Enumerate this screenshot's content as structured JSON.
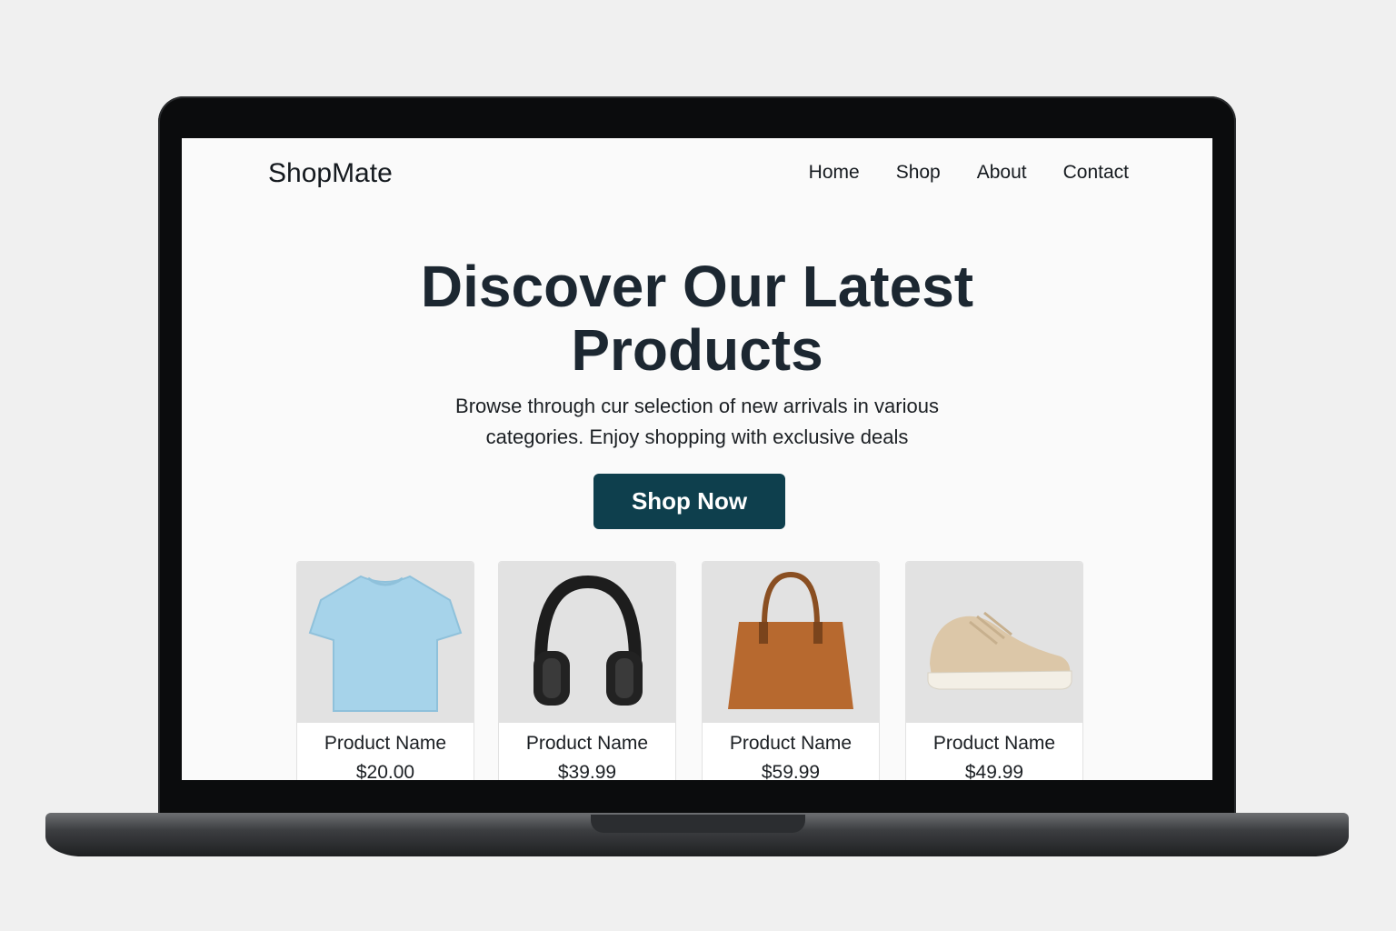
{
  "brand": "ShopMate",
  "nav": [
    "Home",
    "Shop",
    "About",
    "Contact"
  ],
  "hero": {
    "title_line1": "Discover Our Latest",
    "title_line2": "Products",
    "subtitle_line1": "Browse through cur selection of new arrivals in various",
    "subtitle_line2": "categories. Enjoy shopping with exclusive deals",
    "cta": "Shop Now"
  },
  "colors": {
    "accent": "#0e3f4d",
    "heading": "#1c2731",
    "card_image_bg": "#e2e2e2"
  },
  "products": [
    {
      "name": "Product Name",
      "price": "$20.00",
      "image": "tshirt-image"
    },
    {
      "name": "Product Name",
      "price": "$39.99",
      "image": "headphones-image"
    },
    {
      "name": "Product Name",
      "price": "$59.99",
      "image": "handbag-image"
    },
    {
      "name": "Product Name",
      "price": "$49.99",
      "image": "sneaker-image"
    }
  ]
}
